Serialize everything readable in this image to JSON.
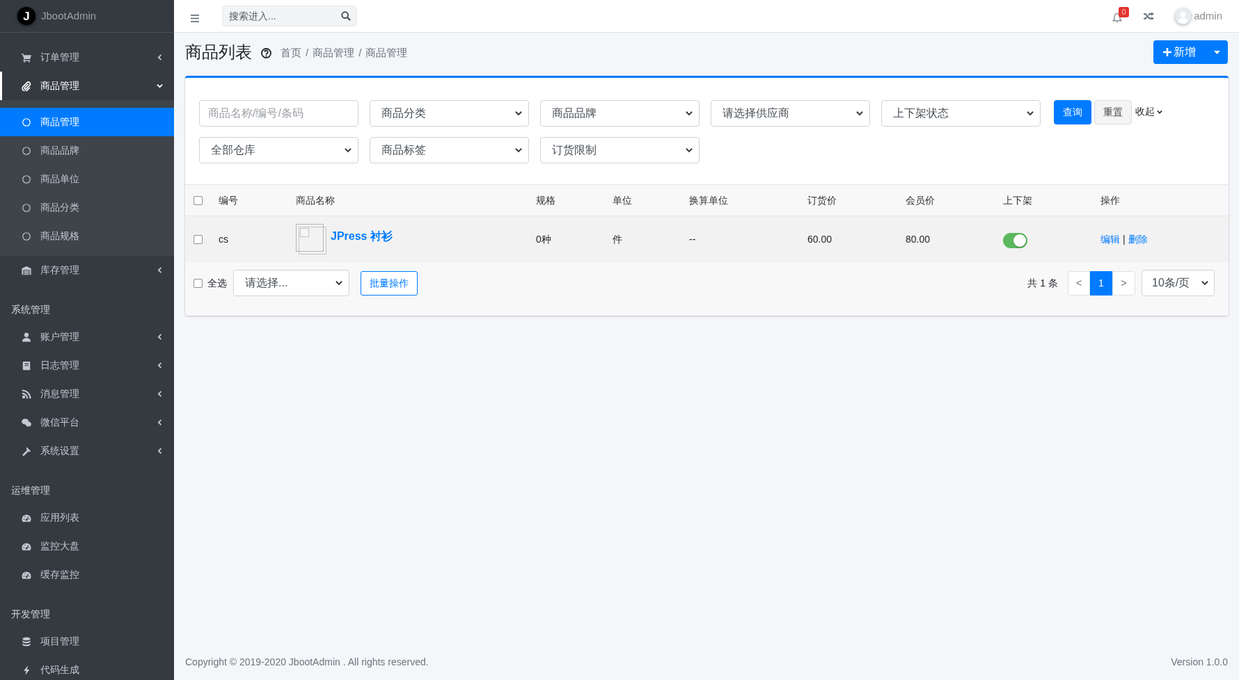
{
  "brand": {
    "logo_letter": "J",
    "name": "JbootAdmin"
  },
  "sidebar": {
    "sections": [
      {
        "items": [
          {
            "label": "订单管理",
            "selected": false,
            "expanded": false
          },
          {
            "label": "商品管理",
            "selected": true,
            "expanded": true,
            "children": [
              {
                "label": "商品管理",
                "selected": true
              },
              {
                "label": "商品品牌",
                "selected": false
              },
              {
                "label": "商品单位",
                "selected": false
              },
              {
                "label": "商品分类",
                "selected": false
              },
              {
                "label": "商品规格",
                "selected": false
              }
            ]
          },
          {
            "label": "库存管理",
            "selected": false,
            "expanded": false
          }
        ]
      },
      {
        "heading": "系统管理",
        "items": [
          {
            "label": "账户管理",
            "selected": false,
            "expanded": false
          },
          {
            "label": "日志管理",
            "selected": false,
            "expanded": false
          },
          {
            "label": "消息管理",
            "selected": false,
            "expanded": false
          },
          {
            "label": "微信平台",
            "selected": false,
            "expanded": false
          },
          {
            "label": "系统设置",
            "selected": false,
            "expanded": false
          }
        ]
      },
      {
        "heading": "运维管理",
        "items": [
          {
            "label": "应用列表",
            "selected": false
          },
          {
            "label": "监控大盘",
            "selected": false
          },
          {
            "label": "缓存监控",
            "selected": false
          }
        ]
      },
      {
        "heading": "开发管理",
        "items": [
          {
            "label": "项目管理",
            "selected": false
          },
          {
            "label": "代码生成",
            "selected": false
          }
        ]
      }
    ]
  },
  "topbar": {
    "search": {
      "placeholder": "搜索进入..."
    },
    "notifications": {
      "count": "0"
    },
    "user": {
      "name": "admin"
    }
  },
  "page_header": {
    "title": "商品列表",
    "breadcrumb": [
      "首页",
      "商品管理",
      "商品管理"
    ],
    "breadcrumb_separator": "/",
    "new_button": {
      "label": "新增"
    }
  },
  "filters": {
    "fields": [
      {
        "kind": "text",
        "placeholder": "商品名称/编号/条码"
      },
      {
        "kind": "select",
        "value": "商品分类"
      },
      {
        "kind": "select",
        "value": "商品品牌"
      },
      {
        "kind": "select",
        "value": "请选择供应商"
      },
      {
        "kind": "select",
        "value": "上下架状态"
      },
      {
        "kind": "select",
        "value": "全部仓库"
      },
      {
        "kind": "select",
        "value": "商品标签"
      },
      {
        "kind": "select",
        "value": "订货限制"
      }
    ],
    "query_button": "查询",
    "reset_button": "重置",
    "collapse_toggle": "收起"
  },
  "table": {
    "select_all_checked": false,
    "columns": [
      "编号",
      "商品名称",
      "规格",
      "单位",
      "换算单位",
      "订货价",
      "会员价",
      "上下架",
      "操作"
    ],
    "action_separator": "|",
    "rows": [
      {
        "checked": false,
        "code": "cs",
        "name": "JPress 衬衫",
        "spec": "0种",
        "unit": "件",
        "conversion_unit": "--",
        "order_price": "60.00",
        "member_price": "80.00",
        "on_shelf": true,
        "actions": [
          "编辑",
          "删除"
        ]
      }
    ]
  },
  "bulk_bar": {
    "select_all": {
      "label": "全选",
      "checked": false
    },
    "action_select": {
      "value": "请选择..."
    },
    "bulk_button": "批量操作"
  },
  "pagination": {
    "total": "共 1 条",
    "prev": "<",
    "next": ">",
    "pages": [
      {
        "label": "1",
        "selected": true
      }
    ],
    "page_size": "10条/页"
  },
  "footer": {
    "copyright": "Copyright © 2019-2020 JbootAdmin . All rights reserved.",
    "version": "Version 1.0.0"
  }
}
